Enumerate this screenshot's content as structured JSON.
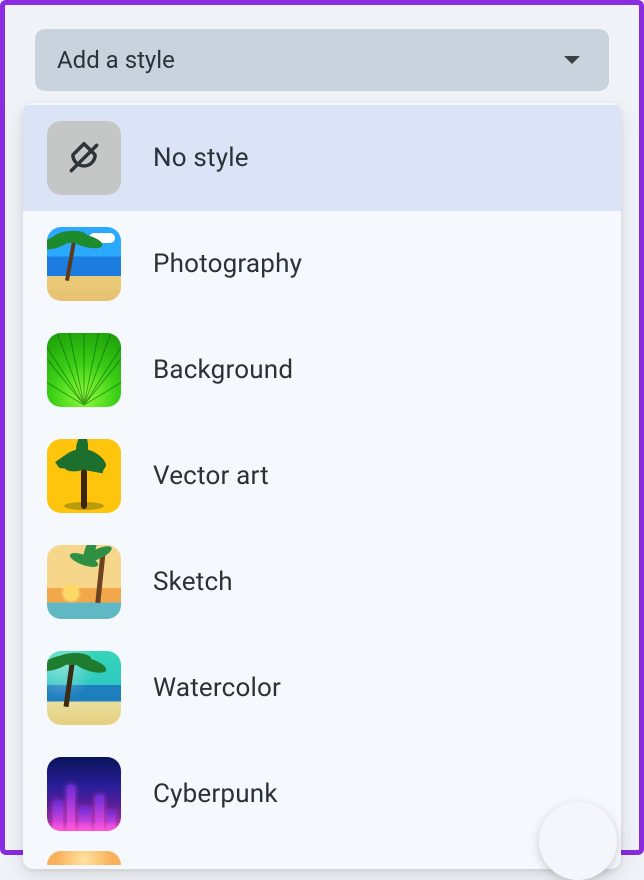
{
  "trigger": {
    "label": "Add a style"
  },
  "options": [
    {
      "id": "no-style",
      "label": "No style",
      "selected": true
    },
    {
      "id": "photography",
      "label": "Photography",
      "selected": false
    },
    {
      "id": "background",
      "label": "Background",
      "selected": false
    },
    {
      "id": "vector-art",
      "label": "Vector art",
      "selected": false
    },
    {
      "id": "sketch",
      "label": "Sketch",
      "selected": false
    },
    {
      "id": "watercolor",
      "label": "Watercolor",
      "selected": false
    },
    {
      "id": "cyberpunk",
      "label": "Cyberpunk",
      "selected": false
    }
  ]
}
